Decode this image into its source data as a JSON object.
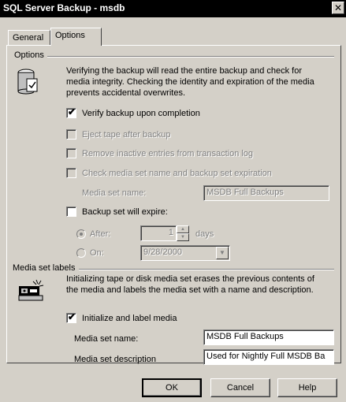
{
  "window": {
    "title": "SQL Server Backup - msdb",
    "close_glyph": "✕"
  },
  "tabs": [
    {
      "label": "General"
    },
    {
      "label": "Options"
    }
  ],
  "options_group": {
    "label": "Options",
    "description": [
      "Verifying the backup will read the entire backup and check for",
      "media integrity. Checking the identity and expiration of the media",
      "prevents accidental overwrites."
    ],
    "verify": {
      "label": "Verify backup upon completion",
      "checked": true
    },
    "eject": {
      "label": "Eject tape after backup",
      "enabled": false
    },
    "remove_inactive": {
      "label": "Remove inactive entries from transaction log",
      "enabled": false
    },
    "check_media": {
      "label": "Check media set name and backup set expiration",
      "enabled": false
    },
    "media_set_name_label": "Media set name:",
    "media_set_name_value": "MSDB Full Backups",
    "expire": {
      "label": "Backup set will expire:",
      "checked": false
    },
    "after_label": "After:",
    "after_value": "1",
    "days_label": "days",
    "on_label": "On:",
    "on_value": "9/28/2000"
  },
  "media_labels_group": {
    "label": "Media set labels",
    "description": [
      "Initializing tape or disk media set erases the previous contents of",
      "the media and labels the media set with a name and description."
    ],
    "initialize": {
      "label": "Initialize and label media",
      "checked": true
    },
    "name_label": "Media set name:",
    "name_value": "MSDB Full Backups",
    "desc_label": "Media set description",
    "desc_value": "Used for Nightly Full MSDB Ba"
  },
  "buttons": {
    "ok": "OK",
    "cancel": "Cancel",
    "help": "Help"
  },
  "icons": {
    "options": "database-check-icon",
    "media": "tape-media-icon",
    "spin_up": "▲",
    "spin_down": "▼",
    "dropdown": "▼"
  }
}
